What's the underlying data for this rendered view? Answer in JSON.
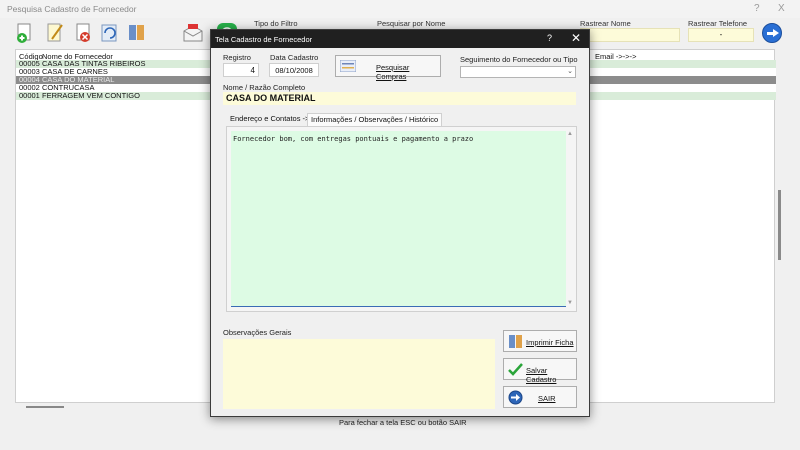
{
  "background_window": {
    "title": "Pesquisa Cadastro de Fornecedor",
    "help_label": "?",
    "close_label": "X",
    "filter_labels": {
      "tipo_filtro": "Tipo do Filtro",
      "pesquisar_nome": "Pesquisar por Nome",
      "rastrear_nome": "Rastrear Nome",
      "rastrear_telefone": "Rastrear Telefone"
    },
    "rastrear_telefone_value": "-",
    "list": {
      "columns": {
        "codigo": "Código",
        "nome": "Nome do Fornecedor",
        "email": "Email ->->->"
      },
      "rows": [
        {
          "codigo": "00005",
          "nome": "CASA DAS TINTAS RIBEIROS",
          "style": "green"
        },
        {
          "codigo": "00003",
          "nome": "CASA DE CARNES",
          "style": "white"
        },
        {
          "codigo": "00004",
          "nome": "CASA DO MATERIAL",
          "style": "gray"
        },
        {
          "codigo": "00002",
          "nome": "CONTRUCASA",
          "style": "white"
        },
        {
          "codigo": "00001",
          "nome": "FERRAGEM VEM CONTIGO",
          "style": "green"
        }
      ]
    },
    "footer_text": "Para fechar a tela ESC ou botão SAIR"
  },
  "dialog": {
    "title": "Tela Cadastro de Fornecedor",
    "help_label": "?",
    "close_label": "✕",
    "registro_label": "Registro",
    "registro_value": "4",
    "data_label": "Data Cadastro",
    "data_value": "08/10/2008",
    "pesquisar_label": "Pesquisar Compras",
    "seguimento_label": "Seguimento do Fornecedor ou Tipo",
    "nome_label": "Nome / Razão Completo",
    "nome_value": "CASA DO MATERIAL",
    "tabs": [
      {
        "label": "Endereço e Contatos ->"
      },
      {
        "label": "Informações / Observações / Histórico"
      }
    ],
    "observacao_text": "Fornecedor bom, com entregas pontuais e pagamento a prazo",
    "obs_gerais_label": "Observações Gerais",
    "buttons": {
      "imprimir": "Imprimir Ficha",
      "salvar": "Salvar Cadastro",
      "sair": "SAIR"
    }
  },
  "colors": {
    "row_green": "#d9ecd9",
    "row_selected": "#8c8c8c",
    "field_yellow": "#fdfbd9",
    "textarea_green": "#ddfbe4",
    "dialog_titlebar": "#202020"
  }
}
